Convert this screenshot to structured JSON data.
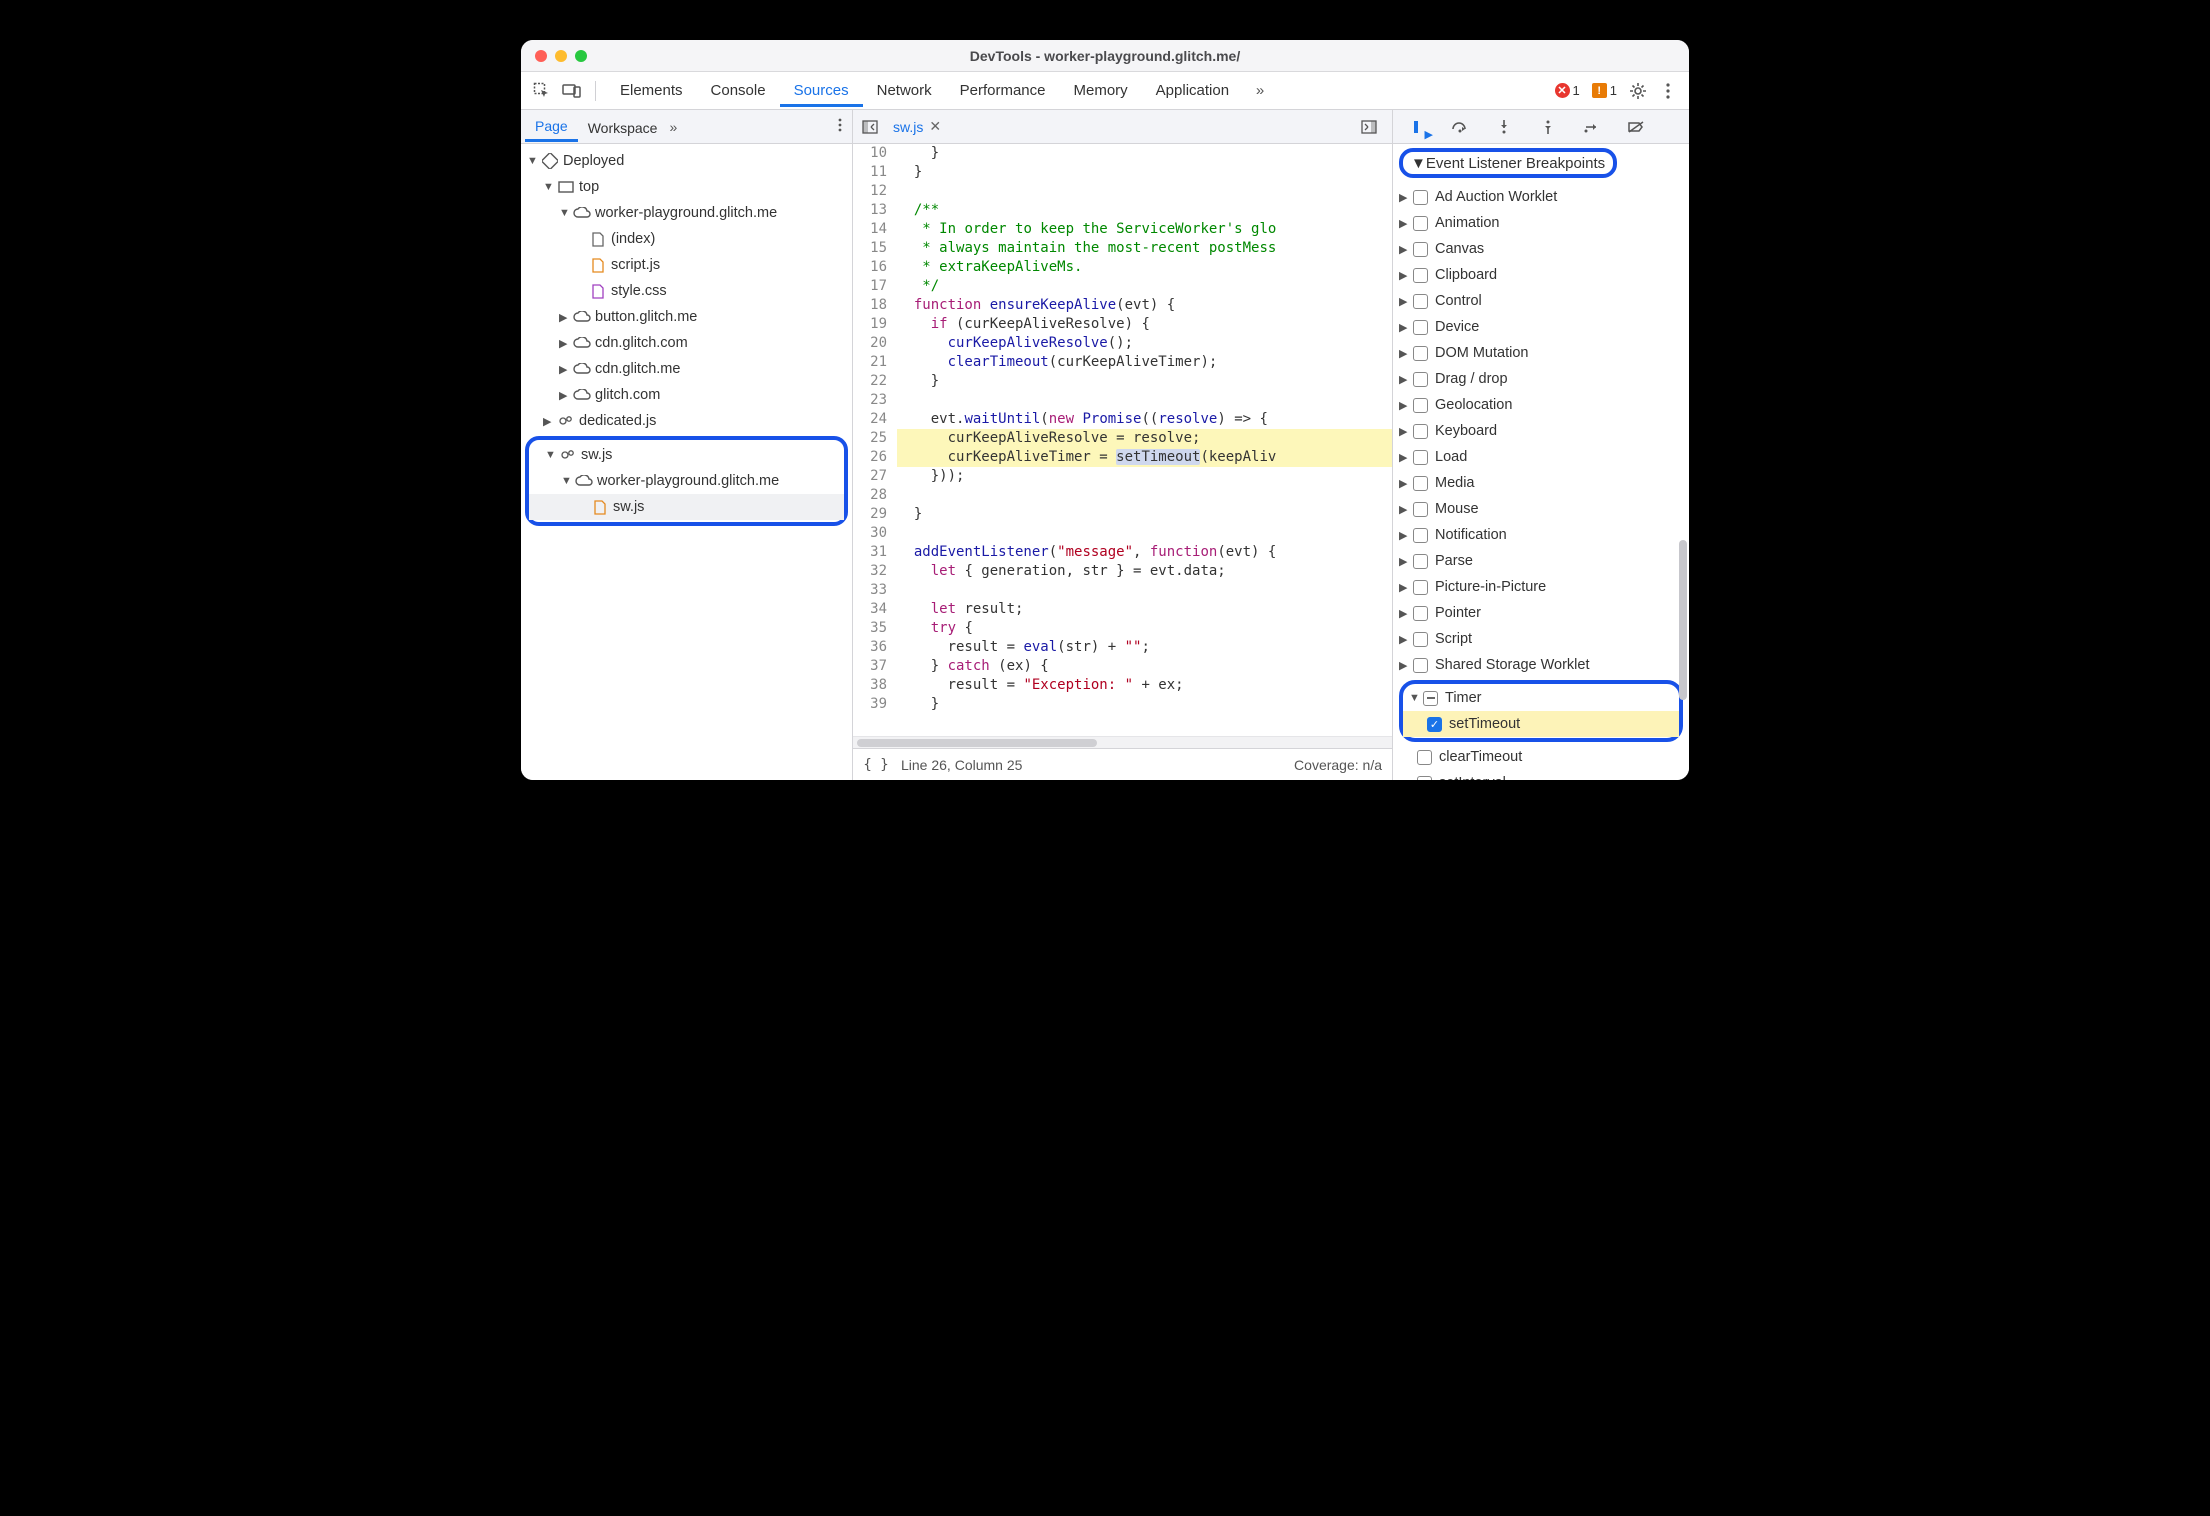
{
  "window": {
    "title": "DevTools - worker-playground.glitch.me/"
  },
  "toolbar": {
    "tabs": [
      "Elements",
      "Console",
      "Sources",
      "Network",
      "Performance",
      "Memory",
      "Application"
    ],
    "active": "Sources",
    "more": "»",
    "errors": "1",
    "warnings": "1"
  },
  "leftPanel": {
    "tabs": [
      "Page",
      "Workspace"
    ],
    "active": "Page",
    "more": "»",
    "tree": {
      "root": "Deployed",
      "top": "top",
      "origin1": "worker-playground.glitch.me",
      "files1": [
        "(index)",
        "script.js",
        "style.css"
      ],
      "origins": [
        "button.glitch.me",
        "cdn.glitch.com",
        "cdn.glitch.me",
        "glitch.com"
      ],
      "dedicated": "dedicated.js",
      "sw": "sw.js",
      "swOrigin": "worker-playground.glitch.me",
      "swFile": "sw.js"
    }
  },
  "editor": {
    "filename": "sw.js",
    "status": "Line 26, Column 25",
    "coverage": "Coverage: n/a",
    "lines": [
      {
        "n": 10,
        "html": "    }"
      },
      {
        "n": 11,
        "html": "  }"
      },
      {
        "n": 12,
        "html": ""
      },
      {
        "n": 13,
        "html": "  <span class='k-cm'>/**</span>"
      },
      {
        "n": 14,
        "html": "   <span class='k-cm'>* In order to keep the ServiceWorker's glo</span>"
      },
      {
        "n": 15,
        "html": "   <span class='k-cm'>* always maintain the most-recent postMess</span>"
      },
      {
        "n": 16,
        "html": "   <span class='k-cm'>* extraKeepAliveMs.</span>"
      },
      {
        "n": 17,
        "html": "   <span class='k-cm'>*/</span>"
      },
      {
        "n": 18,
        "html": "  <span class='k-key'>function</span> <span class='k-fn'>ensureKeepAlive</span>(evt) {"
      },
      {
        "n": 19,
        "html": "    <span class='k-key'>if</span> (curKeepAliveResolve) {"
      },
      {
        "n": 20,
        "html": "      <span class='k-fn'>curKeepAliveResolve</span>();"
      },
      {
        "n": 21,
        "html": "      <span class='k-fn'>clearTimeout</span>(curKeepAliveTimer);"
      },
      {
        "n": 22,
        "html": "    }"
      },
      {
        "n": 23,
        "html": ""
      },
      {
        "n": 24,
        "html": "    evt.<span class='k-fn'>waitUntil</span>(<span class='k-key'>new</span> <span class='k-fn'>Promise</span>((<span class='k-fn'>resolve</span>) =&gt; {"
      },
      {
        "n": 25,
        "html": "      curKeepAliveResolve = resolve;",
        "cls": "hl-yellow"
      },
      {
        "n": 26,
        "html": "      curKeepAliveTimer = <span class='sel-token'>setTimeout</span>(keepAliv",
        "cls": "hl-yellow"
      },
      {
        "n": 27,
        "html": "    }));"
      },
      {
        "n": 28,
        "html": ""
      },
      {
        "n": 29,
        "html": "  }"
      },
      {
        "n": 30,
        "html": ""
      },
      {
        "n": 31,
        "html": "  <span class='k-fn'>addEventListener</span>(<span class='k-str'>\"message\"</span>, <span class='k-key'>function</span>(evt) {"
      },
      {
        "n": 32,
        "html": "    <span class='k-key'>let</span> { generation, str } = evt.data;"
      },
      {
        "n": 33,
        "html": ""
      },
      {
        "n": 34,
        "html": "    <span class='k-key'>let</span> result;"
      },
      {
        "n": 35,
        "html": "    <span class='k-key'>try</span> {"
      },
      {
        "n": 36,
        "html": "      result = <span class='k-fn'>eval</span>(str) + <span class='k-str'>\"\"</span>;"
      },
      {
        "n": 37,
        "html": "    } <span class='k-key'>catch</span> (ex) {"
      },
      {
        "n": 38,
        "html": "      result = <span class='k-str'>\"Exception: \"</span> + ex;"
      },
      {
        "n": 39,
        "html": "    }"
      }
    ]
  },
  "rightPanel": {
    "header": "Event Listener Breakpoints",
    "categories": [
      "Ad Auction Worklet",
      "Animation",
      "Canvas",
      "Clipboard",
      "Control",
      "Device",
      "DOM Mutation",
      "Drag / drop",
      "Geolocation",
      "Keyboard",
      "Load",
      "Media",
      "Mouse",
      "Notification",
      "Parse",
      "Picture-in-Picture",
      "Pointer",
      "Script",
      "Shared Storage Worklet"
    ],
    "timer": {
      "label": "Timer",
      "items": [
        "setTimeout",
        "clearTimeout",
        "setInterval"
      ],
      "checked": "setTimeout"
    }
  }
}
